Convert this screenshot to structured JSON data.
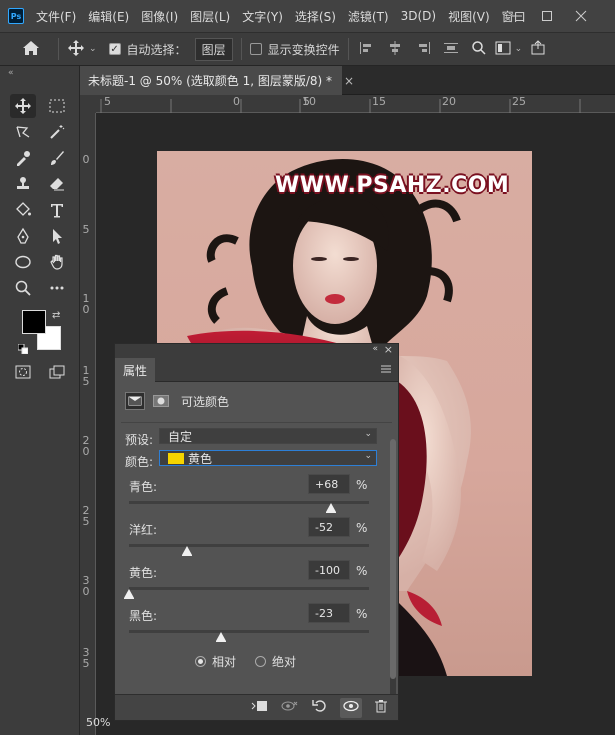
{
  "app": {
    "logo": "Ps"
  },
  "menu": [
    "文件(F)",
    "编辑(E)",
    "图像(I)",
    "图层(L)",
    "文字(Y)",
    "选择(S)",
    "滤镜(T)",
    "3D(D)",
    "视图(V)",
    "窗口"
  ],
  "options": {
    "auto_select_label": "自动选择：",
    "auto_select_target": "图层",
    "show_transform_label": "显示变换控件"
  },
  "document": {
    "tab_title": "未标题-1 @ 50% (选取颜色 1, 图层蒙版/8) *",
    "zoom": "50%",
    "watermark": "WWW.PSAHZ.COM"
  },
  "rulers": {
    "top": [
      "5",
      "0",
      "5",
      "10",
      "15",
      "20",
      "25"
    ],
    "left": [
      "0",
      "5",
      "1\n0",
      "1\n5",
      "2\n0",
      "2\n5",
      "3\n0",
      "3\n5"
    ]
  },
  "properties": {
    "tab": "属性",
    "adjustment_title": "可选颜色",
    "preset_label": "预设:",
    "preset_value": "自定",
    "color_label": "颜色:",
    "color_value": "黄色",
    "color_swatch": "#f5d400",
    "sliders": [
      {
        "label": "青色:",
        "value": "+68",
        "unit": "%",
        "level": 0.84
      },
      {
        "label": "洋红:",
        "value": "-52",
        "unit": "%",
        "level": 0.24
      },
      {
        "label": "黄色:",
        "value": "-100",
        "unit": "%",
        "level": 0.0
      },
      {
        "label": "黑色:",
        "value": "-23",
        "unit": "%",
        "level": 0.385
      }
    ],
    "mode_relative": "相对",
    "mode_absolute": "绝对"
  }
}
